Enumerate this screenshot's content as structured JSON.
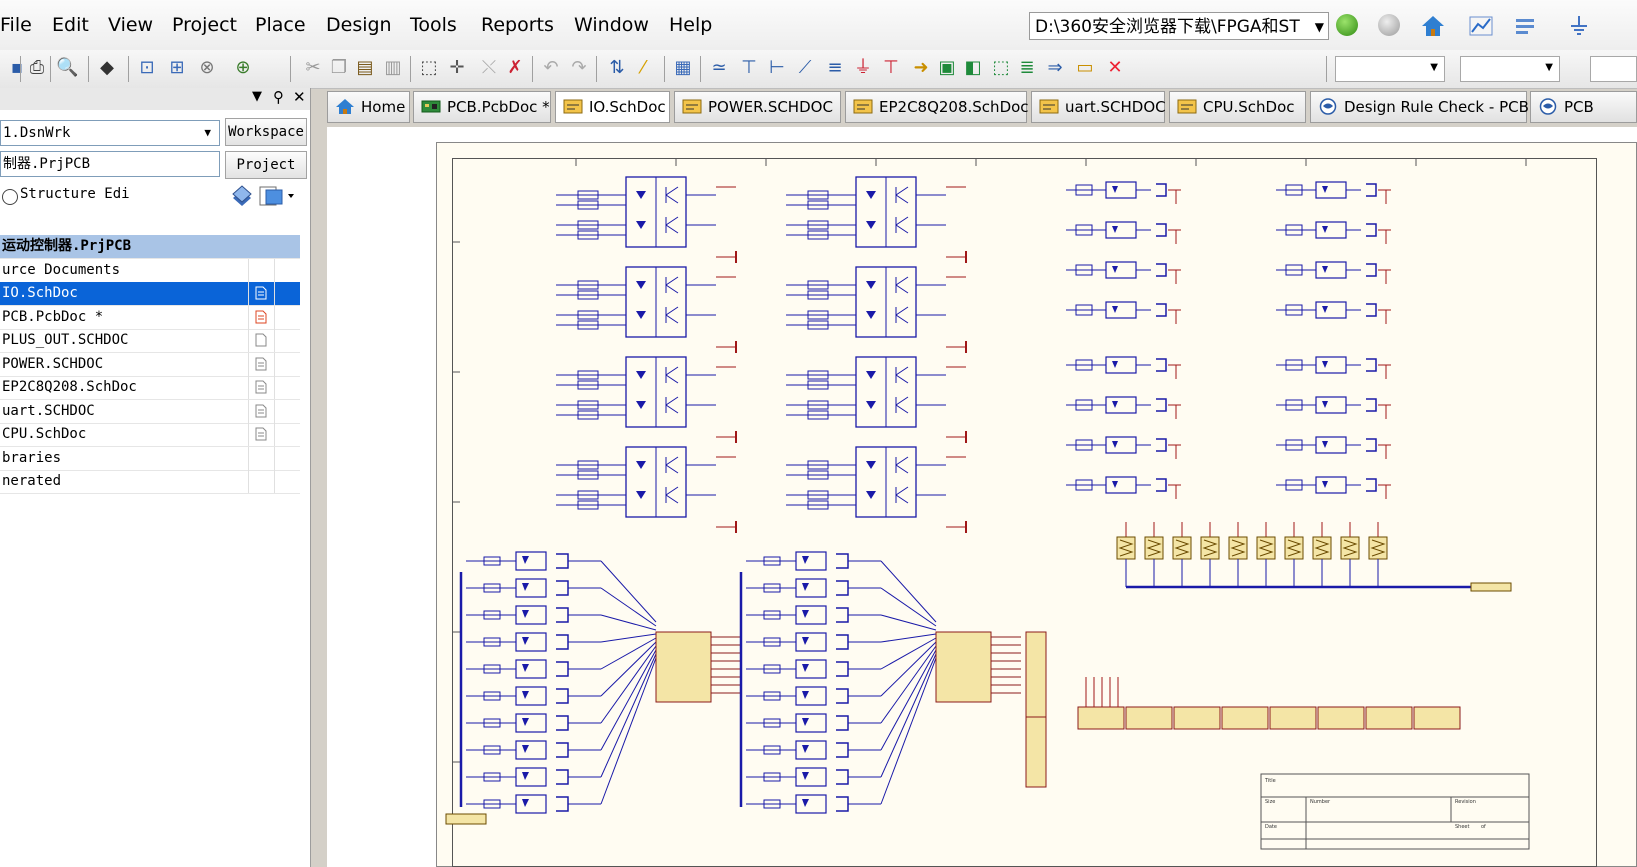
{
  "menu": {
    "items": [
      "File",
      "Edit",
      "View",
      "Project",
      "Place",
      "Design",
      "Tools",
      "Reports",
      "Window",
      "Help"
    ],
    "path": "D:\\360安全浏览器下载\\FPGA和ST"
  },
  "panel": {
    "workspace_value": "1.DsnWrk",
    "workspace_button": "Workspace",
    "project_value": "制器.PrjPCB",
    "project_button": "Project",
    "structure_label": "Structure Edi",
    "tree": [
      {
        "label": "运动控制器.PrjPCB",
        "kind": "header"
      },
      {
        "label": "urce Documents",
        "kind": "folder"
      },
      {
        "label": "IO.SchDoc",
        "kind": "selected"
      },
      {
        "label": "PCB.PcbDoc *",
        "kind": "modified"
      },
      {
        "label": "PLUS_OUT.SCHDOC",
        "kind": "blank"
      },
      {
        "label": "POWER.SCHDOC",
        "kind": "doc"
      },
      {
        "label": "EP2C8Q208.SchDoc",
        "kind": "doc"
      },
      {
        "label": "uart.SCHDOC",
        "kind": "doc"
      },
      {
        "label": "CPU.SchDoc",
        "kind": "doc"
      },
      {
        "label": "braries",
        "kind": "folder"
      },
      {
        "label": "nerated",
        "kind": "folder"
      }
    ]
  },
  "tabs": [
    {
      "label": "Home",
      "icon": "home-icon"
    },
    {
      "label": "PCB.PcbDoc *",
      "icon": "pcb-icon"
    },
    {
      "label": "IO.SchDoc",
      "icon": "schematic-icon",
      "active": true
    },
    {
      "label": "POWER.SCHDOC",
      "icon": "schematic-icon"
    },
    {
      "label": "EP2C8Q208.SchDoc",
      "icon": "schematic-icon"
    },
    {
      "label": "uart.SCHDOC",
      "icon": "schematic-icon"
    },
    {
      "label": "CPU.SchDoc",
      "icon": "schematic-icon"
    },
    {
      "label": "Design Rule Check - PCB",
      "icon": "report-icon"
    },
    {
      "label": "PCB",
      "icon": "report-icon"
    }
  ],
  "titleblock": {
    "title": "Title",
    "size": "Size",
    "number": "Number",
    "revision": "Revision",
    "date": "Date",
    "sheet": "Sheet",
    "of": "of"
  }
}
